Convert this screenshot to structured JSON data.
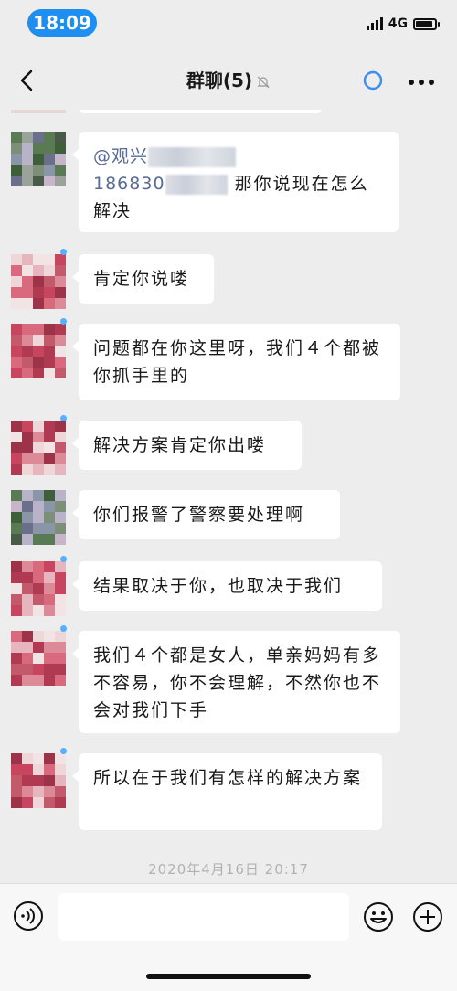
{
  "status": {
    "time": "18:09",
    "network": "4G"
  },
  "nav": {
    "title": "群聊(5)",
    "back_icon": "chevron-left-icon",
    "mute_icon": "bell-off-icon",
    "ring_icon": "circle-ring-icon",
    "more_icon": "more-dots-icon"
  },
  "messages": [
    {
      "sender": "guanxing",
      "mention": "@观兴",
      "number": "186830",
      "text": "那你说现在怎么解决"
    },
    {
      "sender": "other",
      "text": "肯定你说喽"
    },
    {
      "sender": "other",
      "text": "问题都在你这里呀，我们４个都被你抓手里的"
    },
    {
      "sender": "other",
      "text": "解决方案肯定你出喽"
    },
    {
      "sender": "guanxing",
      "text": "你们报警了警察要处理啊"
    },
    {
      "sender": "other",
      "text": "结果取决于你，也取决于我们"
    },
    {
      "sender": "other",
      "text": "我们４个都是女人，单亲妈妈有多不容易，你不会理解，不然你也不会对我们下手"
    },
    {
      "sender": "other",
      "text": "所以在于我们有怎样的解决方案"
    }
  ],
  "timestamp": "2020年4月16日 20:17",
  "input": {
    "value": ""
  },
  "colors": {
    "time_pill": "#1f8ef1",
    "background": "#ededed",
    "link": "#576b95",
    "dot": "#56b0ff"
  }
}
